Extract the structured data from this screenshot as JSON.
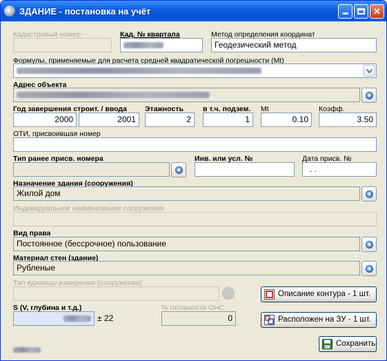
{
  "window": {
    "title": "ЗДАНИЕ - постановка на учёт"
  },
  "fields": {
    "cadastral_number": {
      "label": "Кадастровый номер",
      "value": ""
    },
    "block_number": {
      "label": "Кад. № квартала"
    },
    "coord_method": {
      "label": "Метод определения координат",
      "value": "Геодезический метод"
    },
    "formulas": {
      "label": "Формулы, применяемые для расчета средней квадратической погрешности (Mt)"
    },
    "address": {
      "label": "Адрес объекта"
    },
    "year": {
      "label": "Год завершения строит. / ввода",
      "value1": "2000",
      "value2": "2001"
    },
    "floors": {
      "label": "Этажность",
      "value": "2"
    },
    "underground": {
      "label": "в т.ч. подзем.",
      "value": "1"
    },
    "mt": {
      "label": "Mt",
      "value": "0.10"
    },
    "coef": {
      "label": "Коэфф.",
      "value": "3.50"
    },
    "oti": {
      "label": "ОТИ, присвоившая номер",
      "value": ""
    },
    "prev_number_type": {
      "label": "Тип ранее присв. номера",
      "value": ""
    },
    "inv_number": {
      "label": "Инв. или усл. №",
      "value": ""
    },
    "assign_date": {
      "label": "Дата присв. №",
      "value": " .  ."
    },
    "purpose": {
      "label": "Назначение здания (сооружения)",
      "value": "Жилой дом"
    },
    "individual_name": {
      "label": "Индивидуальное наименование сооружения",
      "value": ""
    },
    "right_type": {
      "label": "Вид права",
      "value": "Постоянное (бессрочное) пользование"
    },
    "wall_material": {
      "label": "Материал стен (здание)",
      "value": "Рубленые"
    },
    "unit_type": {
      "label": "Тип единицы измерения (сооружения)",
      "value": ""
    },
    "area": {
      "label": "S (V, глубина и т.д.)",
      "tolerance": "± 22"
    },
    "readiness": {
      "label": "% готовности ОНС",
      "value": "0"
    }
  },
  "buttons": {
    "contour": "Описание контура - 1 шт.",
    "location": "Расположен на ЗУ - 1 шт.",
    "save": "Сохранить"
  },
  "colors": {
    "titlebar": "#0a5ce0",
    "panel": "#ece9d8",
    "field_border": "#7f9db9",
    "area_field": "#dde7f8",
    "contour_icon": "#c0392b"
  }
}
